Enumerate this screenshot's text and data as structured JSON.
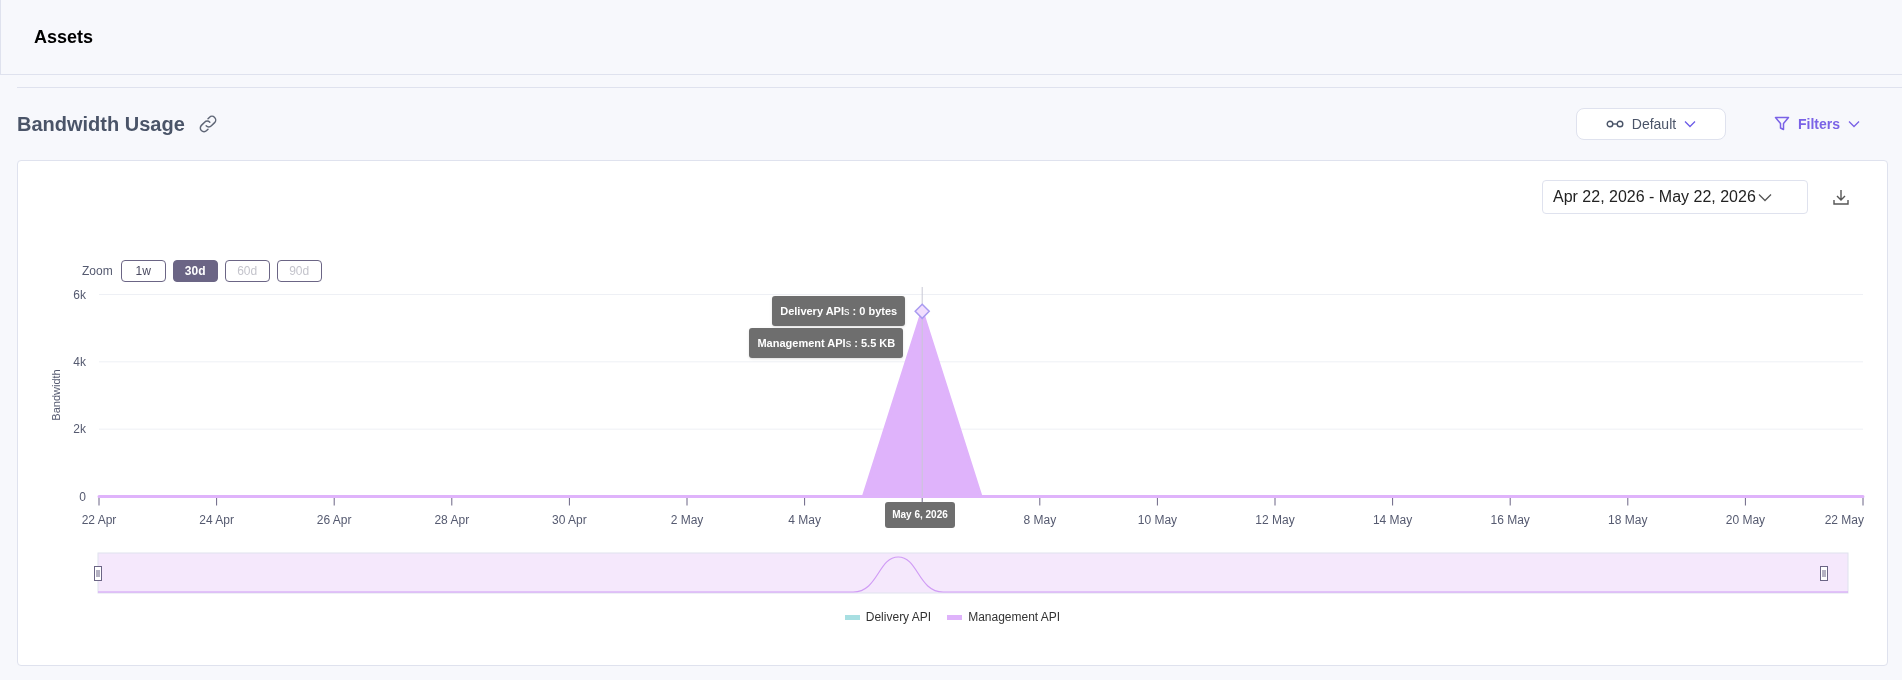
{
  "header": {
    "title": "Assets"
  },
  "section": {
    "title": "Bandwidth Usage"
  },
  "view_button": {
    "label": "Default"
  },
  "filters_button": {
    "label": "Filters"
  },
  "date_range": {
    "value": "Apr 22, 2026 - May 22, 2026"
  },
  "zoom": {
    "label": "Zoom",
    "options": [
      {
        "label": "1w",
        "selected": false,
        "disabled": false
      },
      {
        "label": "30d",
        "selected": true,
        "disabled": false
      },
      {
        "label": "60d",
        "selected": false,
        "disabled": true
      },
      {
        "label": "90d",
        "selected": false,
        "disabled": true
      }
    ]
  },
  "legend_extra": [
    {
      "label": "Delivery API",
      "color": "#a8dfe2"
    }
  ],
  "tooltip": {
    "lines": [
      "**Delivery API**s **: 0 bytes**",
      "**Management API**s **: 5.5 KB**"
    ],
    "date": "May 6, 2026"
  },
  "chart_data": {
    "type": "area",
    "ylabel": "Bandwidth",
    "categories": [
      "22 Apr",
      null,
      "24 Apr",
      null,
      "26 Apr",
      null,
      "28 Apr",
      null,
      "30 Apr",
      null,
      "2 May",
      null,
      "4 May",
      null,
      null,
      null,
      "8 May",
      null,
      "10 May",
      null,
      "12 May",
      null,
      "14 May",
      null,
      "16 May",
      null,
      "18 May",
      null,
      "20 May",
      null,
      "22 May"
    ],
    "series": [
      {
        "name": "Management API",
        "color": "#dfb3fb",
        "values": [
          0,
          0,
          0,
          0,
          0,
          0,
          0,
          0,
          0,
          0,
          0,
          0,
          0,
          0,
          5500,
          0,
          0,
          0,
          0,
          0,
          0,
          0,
          0,
          0,
          0,
          0,
          0,
          0,
          0,
          0,
          0
        ]
      }
    ],
    "ylim": [
      0,
      6000
    ],
    "yticks": [
      {
        "value": 0,
        "label": "0"
      },
      {
        "value": 2000,
        "label": "2k"
      },
      {
        "value": 4000,
        "label": "4k"
      },
      {
        "value": 6000,
        "label": "6k"
      }
    ]
  }
}
